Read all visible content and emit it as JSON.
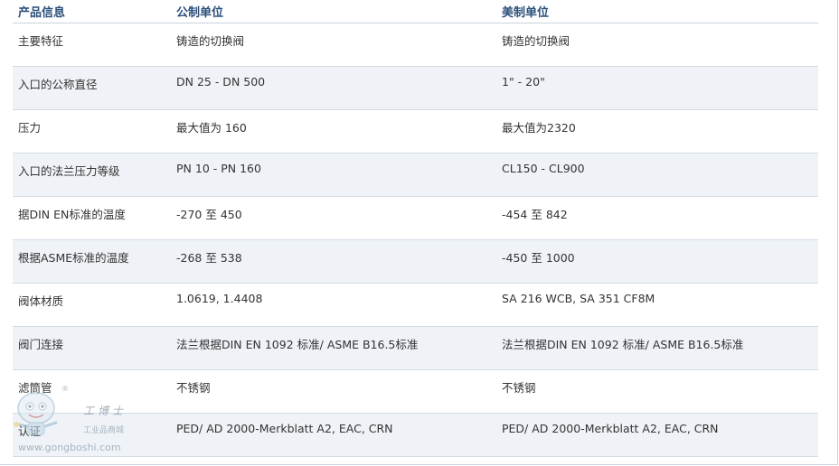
{
  "table": {
    "headers": [
      "产品信息",
      "公制单位",
      "美制单位"
    ],
    "rows": [
      [
        "主要特征",
        "铸造的切换阀",
        "铸造的切换阀"
      ],
      [
        "入口的公称直径",
        "DN 25  -  DN 500",
        "1\"  -  20\""
      ],
      [
        "压力",
        "最大值为 160",
        "最大值为2320"
      ],
      [
        "入口的法兰压力等级",
        "PN 10  -  PN 160",
        "CL150  -  CL900"
      ],
      [
        "据DIN EN标准的温度",
        "-270  至  450",
        "-454  至  842"
      ],
      [
        "根据ASME标准的温度",
        "-268  至  538",
        "-450  至  1000"
      ],
      [
        "阀体材质",
        "1.0619, 1.4408",
        "SA 216 WCB, SA 351 CF8M"
      ],
      [
        "阀门连接",
        "法兰根据DIN EN 1092 标准/ ASME B16.5标准",
        "法兰根据DIN EN 1092 标准/ ASME B16.5标准"
      ],
      [
        "滤筒管",
        "不锈钢",
        "不锈钢"
      ],
      [
        "认证",
        "PED/ AD 2000-Merkblatt A2, EAC, CRN",
        "PED/ AD 2000-Merkblatt A2, EAC, CRN"
      ]
    ]
  },
  "watermark": {
    "brand": "工博士",
    "registered": "®",
    "mall": "工业品商城",
    "url": "www.gongboshi.com"
  },
  "colors": {
    "header_text": "#2b4f7a",
    "row_alt": "#eff3f7",
    "grid": "#d2dbe3"
  }
}
